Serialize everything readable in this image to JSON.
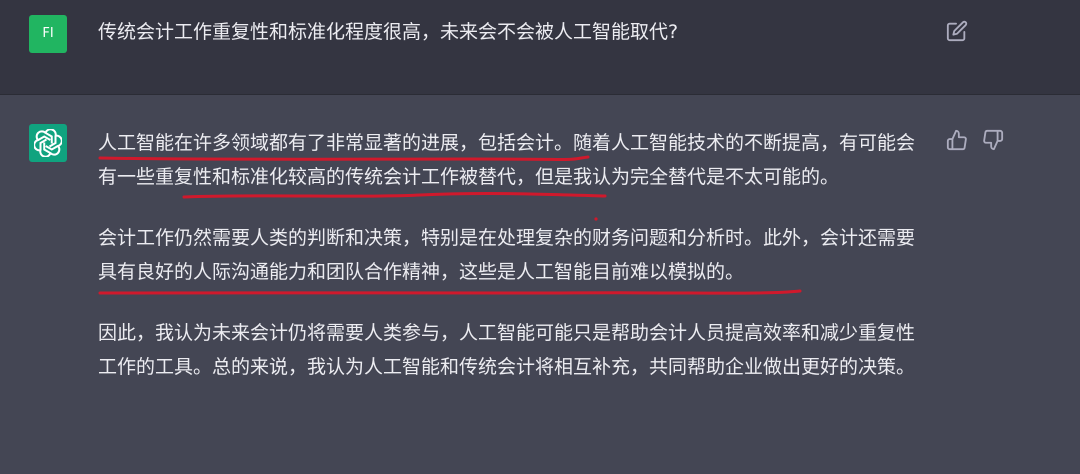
{
  "user_message": {
    "avatar_initials": "FI",
    "avatar_color": "#21b561",
    "text": "传统会计工作重复性和标准化程度很高，未来会不会被人工智能取代?"
  },
  "assistant_message": {
    "avatar_color": "#10a37f",
    "paragraphs": [
      "人工智能在许多领域都有了非常显著的进展，包括会计。随着人工智能技术的不断提高，有可能会有一些重复性和标准化较高的传统会计工作被替代，但是我认为完全替代是不太可能的。",
      "会计工作仍然需要人类的判断和决策，特别是在处理复杂的财务问题和分析时。此外，会计还需要具有良好的人际沟通能力和团队合作精神，这些是人工智能目前难以模拟的。",
      "因此，我认为未来会计仍将需要人类参与，人工智能可能只是帮助会计人员提高效率和减少重复性工作的工具。总的来说，我认为人工智能和传统会计将相互补充，共同帮助企业做出更好的决策。"
    ]
  },
  "icons": {
    "edit": "edit-icon",
    "thumbs_up": "thumbs-up-icon",
    "thumbs_down": "thumbs-down-icon",
    "assistant_logo": "openai-logo-icon"
  },
  "annotation_color": "#d0192c"
}
